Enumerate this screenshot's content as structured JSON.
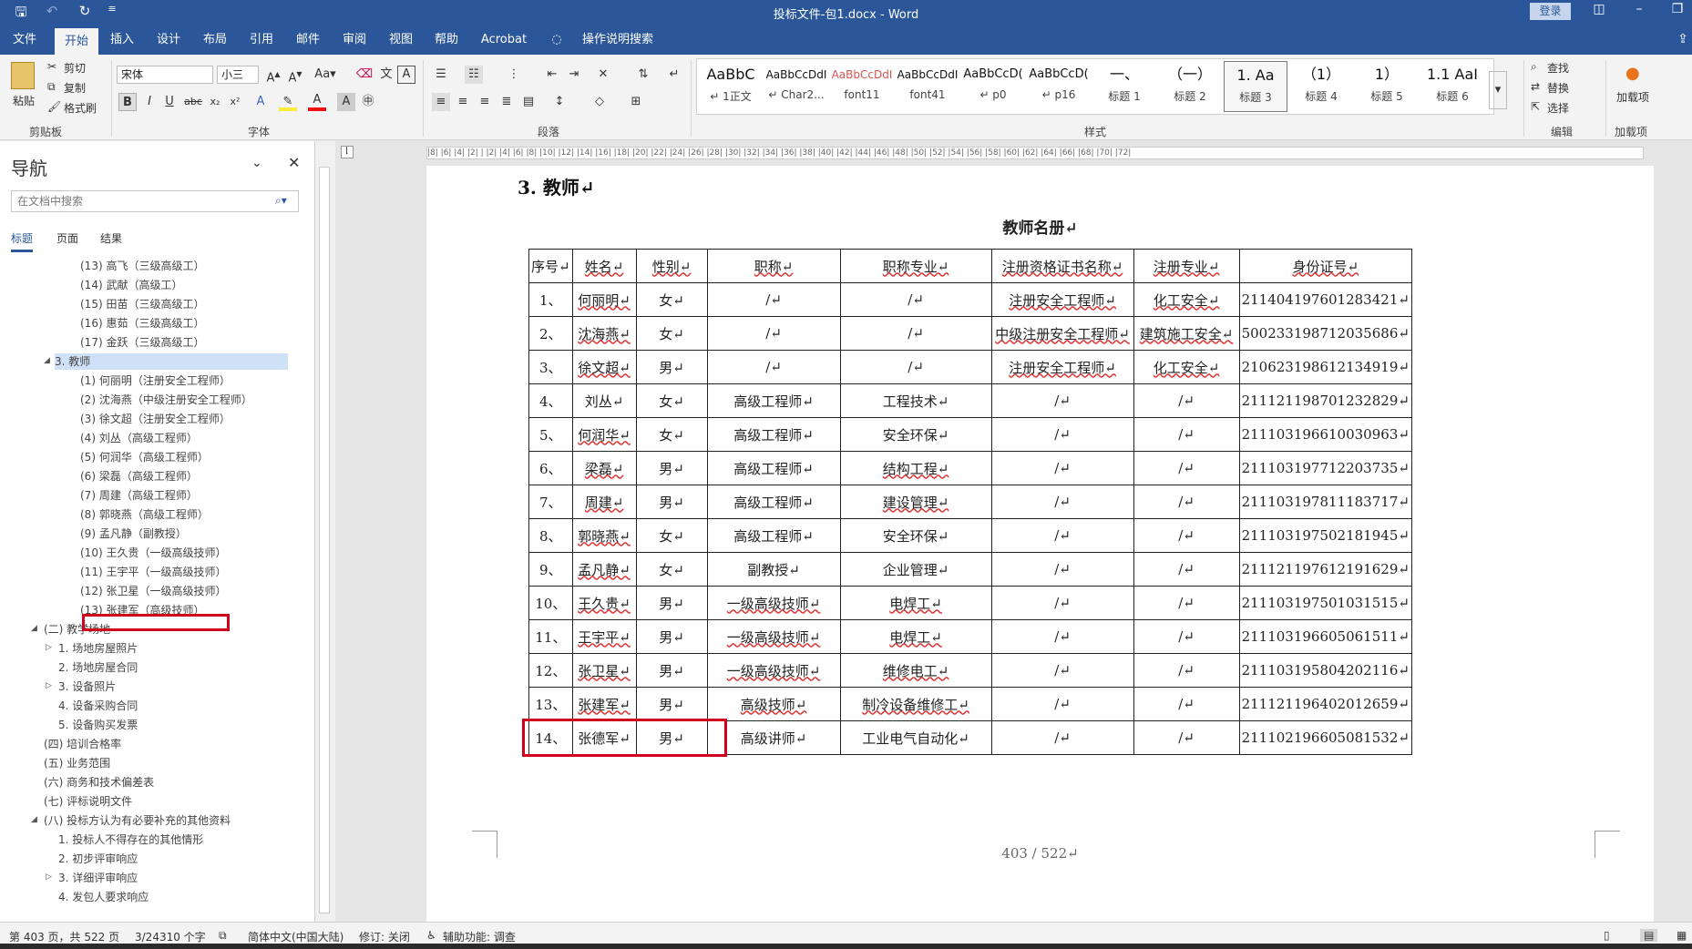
{
  "window": {
    "doc_title": "投标文件-包1.docx - Word",
    "login": "登录"
  },
  "tabs": [
    "文件",
    "开始",
    "插入",
    "设计",
    "布局",
    "引用",
    "邮件",
    "审阅",
    "视图",
    "帮助",
    "Acrobat",
    "操作说明搜索"
  ],
  "ribbon": {
    "clipboard": {
      "paste": "粘贴",
      "cut": "剪切",
      "copy": "复制",
      "format_painter": "格式刷",
      "label": "剪贴板"
    },
    "font": {
      "name": "宋体",
      "size": "小三",
      "label": "字体"
    },
    "paragraph": {
      "label": "段落"
    },
    "styles": {
      "label": "样式",
      "items": [
        {
          "sample": "AaBbC",
          "name": "↵ 1正文"
        },
        {
          "sample": "AaBbCcDdI",
          "name": "↵ Char2..."
        },
        {
          "sample": "AaBbCcDdI",
          "name": "font11"
        },
        {
          "sample": "AaBbCcDdI",
          "name": "font41"
        },
        {
          "sample": "AaBbCcD(",
          "name": "↵ p0"
        },
        {
          "sample": "AaBbCcD(",
          "name": "↵ p16"
        },
        {
          "sample": "一、",
          "name": "标题 1"
        },
        {
          "sample": "（一）",
          "name": "标题 2"
        },
        {
          "sample": "1.  Aa",
          "name": "标题 3"
        },
        {
          "sample": "（1）",
          "name": "标题 4"
        },
        {
          "sample": "1）",
          "name": "标题 5"
        },
        {
          "sample": "Aa",
          "name": "标题 5"
        },
        {
          "sample": "1.1  AaI",
          "name": "标题 6"
        }
      ]
    },
    "editing": {
      "find": "查找",
      "replace": "替换",
      "select": "选择",
      "label": "编辑"
    },
    "addins": {
      "load": "加载项",
      "label": "加载项"
    }
  },
  "nav": {
    "title": "导航",
    "search_placeholder": "在文档中搜索",
    "tabs": [
      "标题",
      "页面",
      "结果"
    ],
    "items": [
      "(13) 高飞（三级高级工）",
      "(14) 武献（高级工）",
      "(15) 田苗（三级高级工）",
      "(16) 惠茹（三级高级工）",
      "(17) 金跃（三级高级工）",
      "3. 教师",
      "(1) 何丽明（注册安全工程师）",
      "(2) 沈海燕（中级注册安全工程师）",
      "(3) 徐文超（注册安全工程师）",
      "(4) 刘丛（高级工程师）",
      "(5) 何润华（高级工程师）",
      "(6) 梁磊（高级工程师）",
      "(7) 周建（高级工程师）",
      "(8) 郭晓燕（高级工程师）",
      "(9) 孟凡静（副教授）",
      "(10) 王久贵（一级高级技师）",
      "(11) 王宇平（一级高级技师）",
      "(12) 张卫星（一级高级技师）",
      "(13) 张建军（高级技师）",
      "(二) 教学场地",
      "1. 场地房屋照片",
      "2. 场地房屋合同",
      "3. 设备照片",
      "4. 设备采购合同",
      "5. 设备购买发票",
      "(四) 培训合格率",
      "(五) 业务范围",
      "(六) 商务和技术偏差表",
      "(七) 评标说明文件",
      "(八) 投标方认为有必要补充的其他资料",
      "1. 投标人不得存在的其他情形",
      "2. 初步评审响应",
      "3. 详细评审响应",
      "4. 发包人要求响应"
    ]
  },
  "ruler": "|8| |6| |4| |2| | |2| |4| |6| |8| |10| |12| |14| |16| |18| |20| |22| |24| |26| |28| |30| |32| |34| |36| |38| |40| |42| |44| |46| |48| |50| |52| |54| |56| |58| |60| |62| |64| |66| |68| |70| |72|",
  "document": {
    "heading": "3.  教师↵",
    "caption": "教师名册↵",
    "columns": [
      "序号↵",
      "姓名↵",
      "性别↵",
      "职称↵",
      "职称专业↵",
      "注册资格证书名称↵",
      "注册专业↵",
      "身份证号↵"
    ],
    "rows": [
      [
        "1、",
        "何丽明↵",
        "女↵",
        "/↵",
        "/↵",
        "注册安全工程师↵",
        "化工安全↵",
        "211404197601283421↵"
      ],
      [
        "2、",
        "沈海燕↵",
        "女↵",
        "/↵",
        "/↵",
        "中级注册安全工程师↵",
        "建筑施工安全↵",
        "500233198712035686↵"
      ],
      [
        "3、",
        "徐文超↵",
        "男↵",
        "/↵",
        "/↵",
        "注册安全工程师↵",
        "化工安全↵",
        "210623198612134919↵"
      ],
      [
        "4、",
        "刘丛↵",
        "女↵",
        "高级工程师↵",
        "工程技术↵",
        "/↵",
        "/↵",
        "211121198701232829↵"
      ],
      [
        "5、",
        "何润华↵",
        "女↵",
        "高级工程师↵",
        "安全环保↵",
        "/↵",
        "/↵",
        "211103196610030963↵"
      ],
      [
        "6、",
        "梁磊↵",
        "男↵",
        "高级工程师↵",
        "结构工程↵",
        "/↵",
        "/↵",
        "211103197712203735↵"
      ],
      [
        "7、",
        "周建↵",
        "男↵",
        "高级工程师↵",
        "建设管理↵",
        "/↵",
        "/↵",
        "211103197811183717↵"
      ],
      [
        "8、",
        "郭晓燕↵",
        "女↵",
        "高级工程师↵",
        "安全环保↵",
        "/↵",
        "/↵",
        "211103197502181945↵"
      ],
      [
        "9、",
        "孟凡静↵",
        "女↵",
        "副教授↵",
        "企业管理↵",
        "/↵",
        "/↵",
        "211121197612191629↵"
      ],
      [
        "10、",
        "王久贵↵",
        "男↵",
        "一级高级技师↵",
        "电焊工↵",
        "/↵",
        "/↵",
        "211103197501031515↵"
      ],
      [
        "11、",
        "王宇平↵",
        "男↵",
        "一级高级技师↵",
        "电焊工↵",
        "/↵",
        "/↵",
        "211103196605061511↵"
      ],
      [
        "12、",
        "张卫星↵",
        "男↵",
        "一级高级技师↵",
        "维修电工↵",
        "/↵",
        "/↵",
        "211103195804202116↵"
      ],
      [
        "13、",
        "张建军↵",
        "男↵",
        "高级技师↵",
        "制冷设备维修工↵",
        "/↵",
        "/↵",
        "211121196402012659↵"
      ],
      [
        "14、",
        "张德军↵",
        "男↵",
        "高级讲师↵",
        "工业电气自动化↵",
        "/↵",
        "/↵",
        "211102196605081532↵"
      ]
    ],
    "page_number": "403  /  522↵"
  },
  "status": {
    "page": "第 403 页，共 522 页",
    "words": "3/24310 个字",
    "lang": "简体中文(中国大陆)",
    "track": "修订: 关闭",
    "access": "辅助功能: 调查"
  }
}
